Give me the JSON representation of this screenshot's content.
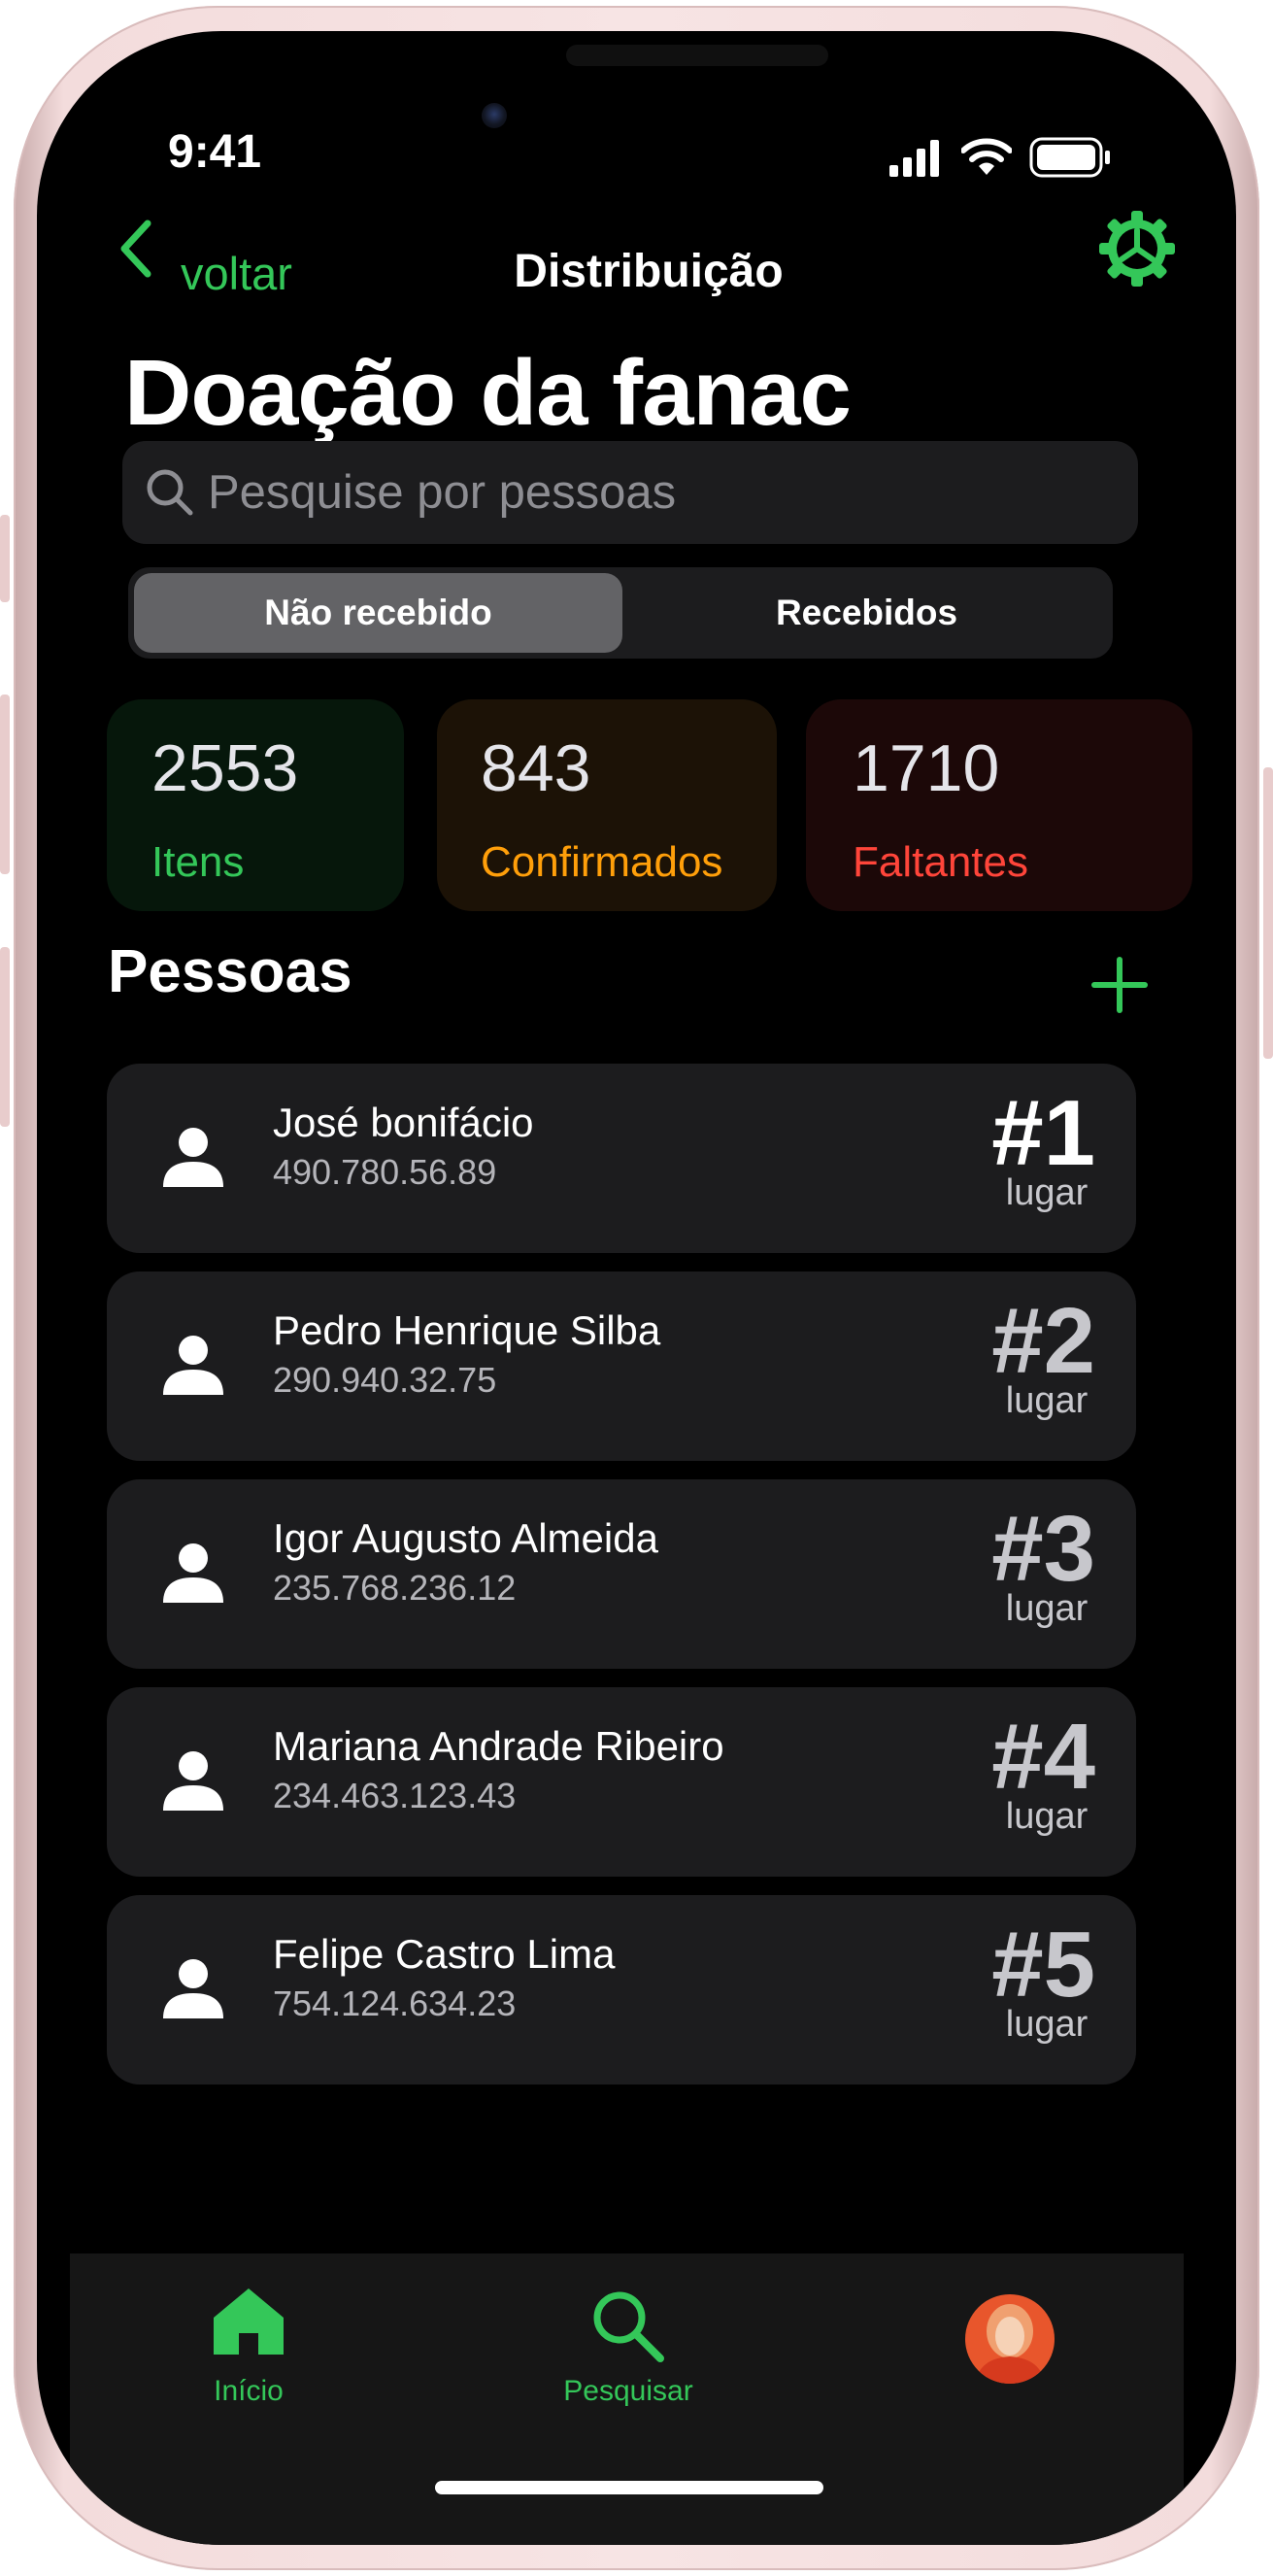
{
  "status_bar": {
    "time": "9:41"
  },
  "nav": {
    "back_label": "voltar",
    "title": "Distribuição"
  },
  "page": {
    "title": "Doação da fanac"
  },
  "search": {
    "placeholder": "Pesquise por pessoas"
  },
  "segmented": {
    "options": [
      "Não recebido",
      "Recebidos"
    ],
    "selected": "Não recebido"
  },
  "stats": [
    {
      "value": "2553",
      "label": "Itens",
      "color": "#34c759",
      "bg": "#06170b"
    },
    {
      "value": "843",
      "label": "Confirmados",
      "color": "#ff9f0a",
      "bg": "#1c1206"
    },
    {
      "value": "1710",
      "label": "Faltantes",
      "color": "#ff453a",
      "bg": "#1c0808"
    }
  ],
  "section": {
    "title": "Pessoas"
  },
  "people": [
    {
      "name": "José bonifácio",
      "id": "490.780.56.89",
      "rank": "#1",
      "rank_label": "lugar"
    },
    {
      "name": "Pedro Henrique Silba",
      "id": "290.940.32.75",
      "rank": "#2",
      "rank_label": "lugar"
    },
    {
      "name": "Igor Augusto Almeida",
      "id": "235.768.236.12",
      "rank": "#3",
      "rank_label": "lugar"
    },
    {
      "name": "Mariana Andrade Ribeiro",
      "id": "234.463.123.43",
      "rank": "#4",
      "rank_label": "lugar"
    },
    {
      "name": "Felipe Castro Lima",
      "id": "754.124.634.23",
      "rank": "#5",
      "rank_label": "lugar"
    }
  ],
  "tabbar": {
    "items": [
      "Início",
      "Pesquisar"
    ]
  },
  "colors": {
    "accent": "#34c759",
    "background": "#000000",
    "card": "#1c1c1e"
  }
}
